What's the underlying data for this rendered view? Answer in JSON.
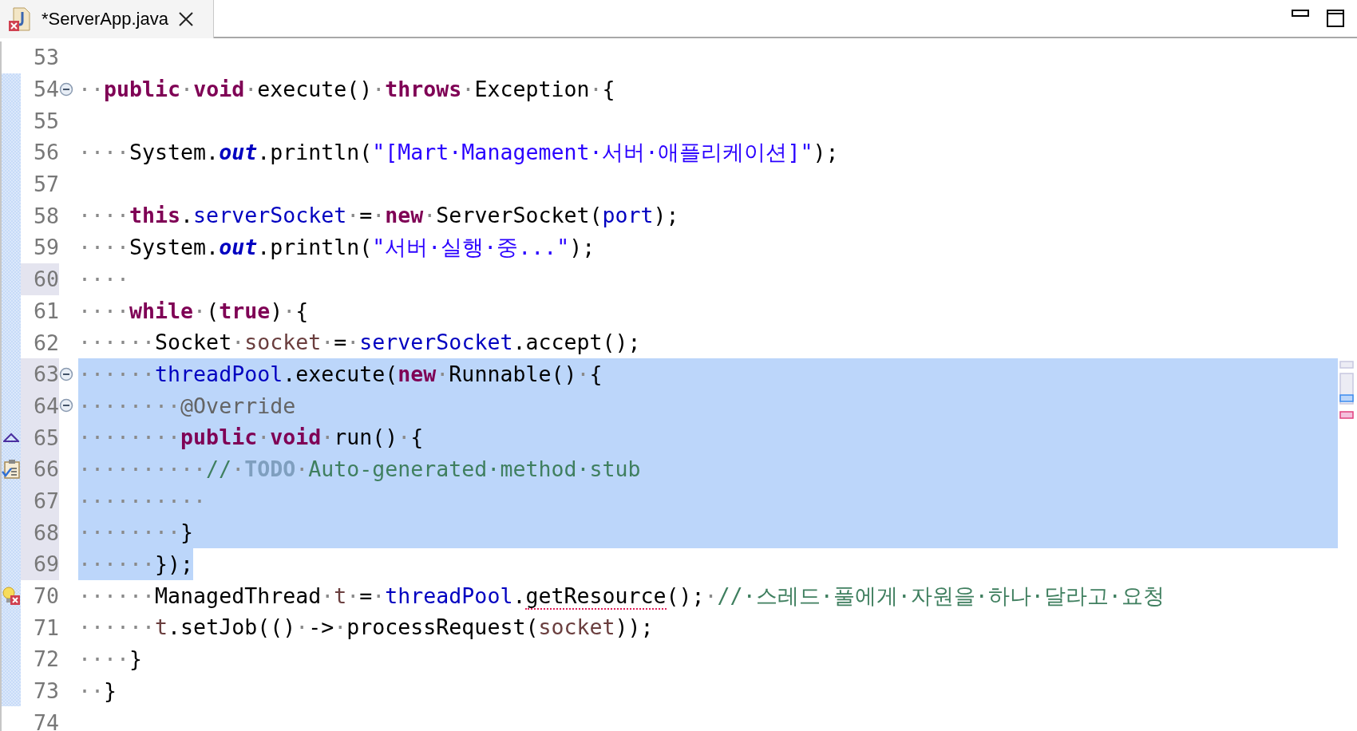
{
  "tab": {
    "title": "*ServerApp.java",
    "selected": true,
    "has_error": true
  },
  "lines": [
    {
      "number": "53",
      "highlight": false,
      "in_range": false
    },
    {
      "number": "54",
      "highlight": false,
      "in_range": true,
      "fold": true,
      "tokens": [
        {
          "kind": "ws",
          "text": "··"
        },
        {
          "kind": "kw",
          "text": "public"
        },
        {
          "kind": "ws",
          "text": "·"
        },
        {
          "kind": "kw",
          "text": "void"
        },
        {
          "kind": "ws",
          "text": "·"
        },
        {
          "kind": "p",
          "text": "execute()"
        },
        {
          "kind": "ws",
          "text": "·"
        },
        {
          "kind": "kw",
          "text": "throws"
        },
        {
          "kind": "ws",
          "text": "·"
        },
        {
          "kind": "p",
          "text": "Exception"
        },
        {
          "kind": "ws",
          "text": "·"
        },
        {
          "kind": "p",
          "text": "{"
        }
      ]
    },
    {
      "number": "55",
      "highlight": false,
      "in_range": true
    },
    {
      "number": "56",
      "highlight": false,
      "in_range": true,
      "tokens": [
        {
          "kind": "ws",
          "text": "····"
        },
        {
          "kind": "p",
          "text": "System."
        },
        {
          "kind": "static",
          "text": "out"
        },
        {
          "kind": "p",
          "text": ".println("
        },
        {
          "kind": "str",
          "text": "\"[Mart·Management·서버·애플리케이션]\""
        },
        {
          "kind": "p",
          "text": ");"
        }
      ]
    },
    {
      "number": "57",
      "highlight": false,
      "in_range": true
    },
    {
      "number": "58",
      "highlight": false,
      "in_range": true,
      "tokens": [
        {
          "kind": "ws",
          "text": "····"
        },
        {
          "kind": "kw",
          "text": "this"
        },
        {
          "kind": "p",
          "text": "."
        },
        {
          "kind": "field",
          "text": "serverSocket"
        },
        {
          "kind": "ws",
          "text": "·"
        },
        {
          "kind": "p",
          "text": "="
        },
        {
          "kind": "ws",
          "text": "·"
        },
        {
          "kind": "kw",
          "text": "new"
        },
        {
          "kind": "ws",
          "text": "·"
        },
        {
          "kind": "p",
          "text": "ServerSocket("
        },
        {
          "kind": "field",
          "text": "port"
        },
        {
          "kind": "p",
          "text": ");"
        }
      ]
    },
    {
      "number": "59",
      "highlight": false,
      "in_range": true,
      "tokens": [
        {
          "kind": "ws",
          "text": "····"
        },
        {
          "kind": "p",
          "text": "System."
        },
        {
          "kind": "static",
          "text": "out"
        },
        {
          "kind": "p",
          "text": ".println("
        },
        {
          "kind": "str",
          "text": "\"서버·실행·중...\""
        },
        {
          "kind": "p",
          "text": ");"
        }
      ]
    },
    {
      "number": "60",
      "highlight": true,
      "in_range": true,
      "tokens": [
        {
          "kind": "ws",
          "text": "····"
        }
      ]
    },
    {
      "number": "61",
      "highlight": false,
      "in_range": true,
      "tokens": [
        {
          "kind": "ws",
          "text": "····"
        },
        {
          "kind": "kw",
          "text": "while"
        },
        {
          "kind": "ws",
          "text": "·"
        },
        {
          "kind": "p",
          "text": "("
        },
        {
          "kind": "kw",
          "text": "true"
        },
        {
          "kind": "p",
          "text": ")"
        },
        {
          "kind": "ws",
          "text": "·"
        },
        {
          "kind": "p",
          "text": "{"
        }
      ]
    },
    {
      "number": "62",
      "highlight": false,
      "in_range": true,
      "tokens": [
        {
          "kind": "ws",
          "text": "······"
        },
        {
          "kind": "p",
          "text": "Socket"
        },
        {
          "kind": "ws",
          "text": "·"
        },
        {
          "kind": "local",
          "text": "socket"
        },
        {
          "kind": "ws",
          "text": "·"
        },
        {
          "kind": "p",
          "text": "="
        },
        {
          "kind": "ws",
          "text": "·"
        },
        {
          "kind": "field",
          "text": "serverSocket"
        },
        {
          "kind": "p",
          "text": ".accept();"
        }
      ]
    },
    {
      "number": "63",
      "highlight": true,
      "in_range": true,
      "fold": true,
      "selected": true,
      "tokens": [
        {
          "kind": "ws",
          "text": "······"
        },
        {
          "kind": "field",
          "text": "threadPool"
        },
        {
          "kind": "p",
          "text": ".execute("
        },
        {
          "kind": "kw",
          "text": "new"
        },
        {
          "kind": "ws",
          "text": "·"
        },
        {
          "kind": "p",
          "text": "Runnable()"
        },
        {
          "kind": "ws",
          "text": "·"
        },
        {
          "kind": "p",
          "text": "{"
        }
      ]
    },
    {
      "number": "64",
      "highlight": true,
      "in_range": true,
      "fold": true,
      "selected": true,
      "tokens": [
        {
          "kind": "ws",
          "text": "········"
        },
        {
          "kind": "annot",
          "text": "@Override"
        }
      ]
    },
    {
      "number": "65",
      "highlight": true,
      "in_range": true,
      "annotations": [
        {
          "kind": "override"
        }
      ],
      "selected": true,
      "tokens": [
        {
          "kind": "ws",
          "text": "········"
        },
        {
          "kind": "kw",
          "text": "public"
        },
        {
          "kind": "ws",
          "text": "·"
        },
        {
          "kind": "kw",
          "text": "void"
        },
        {
          "kind": "ws",
          "text": "·"
        },
        {
          "kind": "p",
          "text": "run()"
        },
        {
          "kind": "ws",
          "text": "·"
        },
        {
          "kind": "p",
          "text": "{"
        }
      ]
    },
    {
      "number": "66",
      "highlight": true,
      "in_range": true,
      "annotations": [
        {
          "kind": "task"
        }
      ],
      "selected": true,
      "tokens": [
        {
          "kind": "ws",
          "text": "··········"
        },
        {
          "kind": "comment",
          "text": "//"
        },
        {
          "kind": "ws",
          "text": "·"
        },
        {
          "kind": "todo",
          "text": "TODO"
        },
        {
          "kind": "ws",
          "text": "·"
        },
        {
          "kind": "comment",
          "text": "Auto-generated·method·stub"
        }
      ]
    },
    {
      "number": "67",
      "highlight": true,
      "in_range": true,
      "selected": true,
      "tokens": [
        {
          "kind": "ws",
          "text": "··········"
        }
      ]
    },
    {
      "number": "68",
      "highlight": true,
      "in_range": true,
      "selected": true,
      "tokens": [
        {
          "kind": "ws",
          "text": "········"
        },
        {
          "kind": "p",
          "text": "}"
        }
      ]
    },
    {
      "number": "69",
      "highlight": true,
      "in_range": true,
      "selected": true,
      "tokens": [
        {
          "kind": "ws",
          "text": "······"
        },
        {
          "kind": "p",
          "text": "});"
        }
      ]
    },
    {
      "number": "70",
      "highlight": false,
      "in_range": true,
      "annotations": [
        {
          "kind": "error"
        }
      ],
      "tokens": [
        {
          "kind": "ws",
          "text": "······"
        },
        {
          "kind": "p",
          "text": "ManagedThread"
        },
        {
          "kind": "ws",
          "text": "·"
        },
        {
          "kind": "local",
          "text": "t"
        },
        {
          "kind": "ws",
          "text": "·"
        },
        {
          "kind": "p",
          "text": "="
        },
        {
          "kind": "ws",
          "text": "·"
        },
        {
          "kind": "field",
          "text": "threadPool"
        },
        {
          "kind": "p",
          "text": "."
        },
        {
          "kind": "err",
          "text": "getResource"
        },
        {
          "kind": "p",
          "text": "();"
        },
        {
          "kind": "ws",
          "text": "·"
        },
        {
          "kind": "comment",
          "text": "//·스레드·풀에게·자원을·하나·달라고·요청"
        }
      ]
    },
    {
      "number": "71",
      "highlight": false,
      "in_range": true,
      "tokens": [
        {
          "kind": "ws",
          "text": "······"
        },
        {
          "kind": "local",
          "text": "t"
        },
        {
          "kind": "p",
          "text": ".setJob(()"
        },
        {
          "kind": "ws",
          "text": "·"
        },
        {
          "kind": "p",
          "text": "->"
        },
        {
          "kind": "ws",
          "text": "·"
        },
        {
          "kind": "p",
          "text": "processRequest("
        },
        {
          "kind": "local",
          "text": "socket"
        },
        {
          "kind": "p",
          "text": "));"
        }
      ]
    },
    {
      "number": "72",
      "highlight": false,
      "in_range": true,
      "tokens": [
        {
          "kind": "ws",
          "text": "····"
        },
        {
          "kind": "p",
          "text": "}"
        }
      ]
    },
    {
      "number": "73",
      "highlight": false,
      "in_range": true,
      "tokens": [
        {
          "kind": "ws",
          "text": "··"
        },
        {
          "kind": "p",
          "text": "}"
        }
      ]
    },
    {
      "number": "74",
      "highlight": false,
      "in_range": false
    }
  ]
}
